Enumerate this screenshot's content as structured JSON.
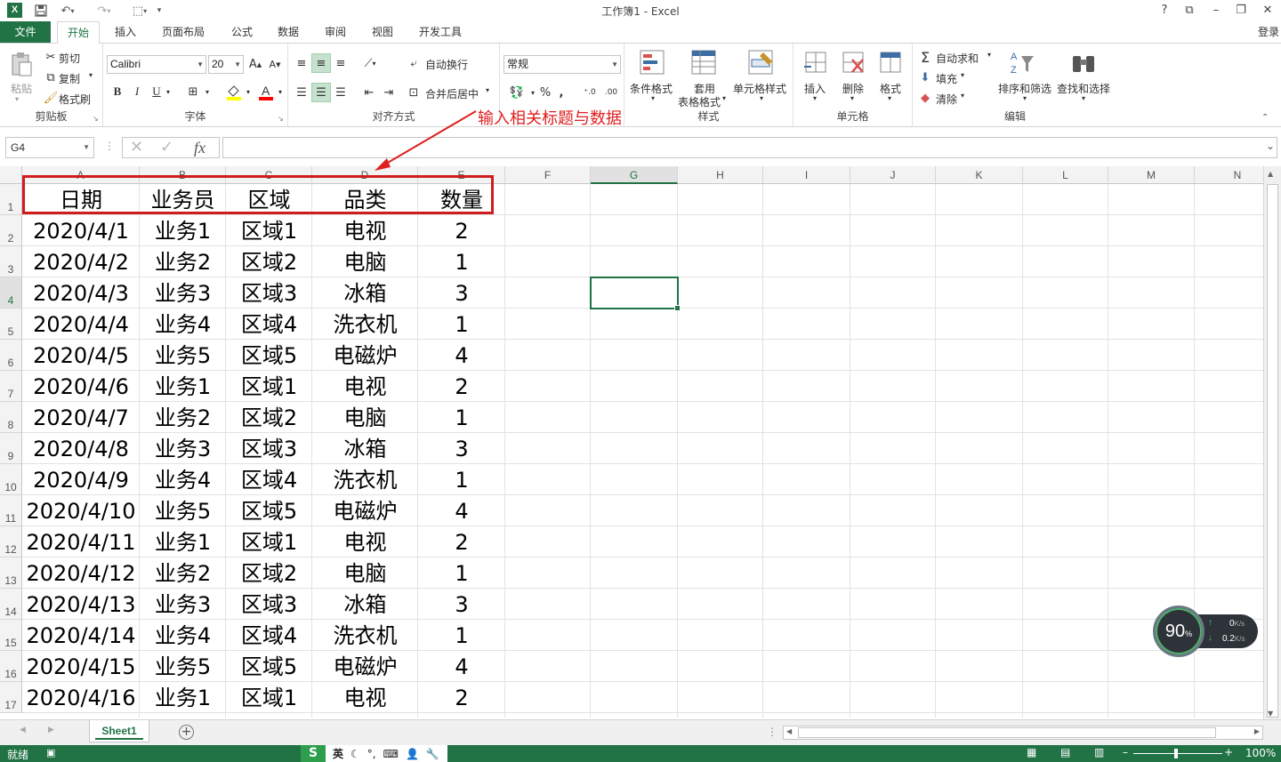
{
  "window": {
    "title": "工作簿1 - Excel",
    "help": "?",
    "login": "登录"
  },
  "tabs": {
    "file": "文件",
    "home": "开始",
    "insert": "插入",
    "page_layout": "页面布局",
    "formulas": "公式",
    "data": "数据",
    "review": "审阅",
    "view": "视图",
    "developer": "开发工具"
  },
  "ribbon": {
    "clipboard": {
      "label": "剪贴板",
      "paste": "粘贴",
      "cut": "剪切",
      "copy": "复制",
      "format_painter": "格式刷"
    },
    "font": {
      "label": "字体",
      "family": "Calibri",
      "size": "20",
      "bold": "B",
      "italic": "I",
      "underline": "U"
    },
    "alignment": {
      "label": "对齐方式",
      "wrap": "自动换行",
      "merge": "合并后居中"
    },
    "number": {
      "format": "常规",
      "percent": "%",
      "comma": ","
    },
    "styles": {
      "label": "样式",
      "conditional": "条件格式",
      "table_line1": "套用",
      "table_line2": "表格格式",
      "cell_styles": "单元格样式"
    },
    "cells": {
      "label": "单元格",
      "insert": "插入",
      "delete": "删除",
      "format": "格式"
    },
    "editing": {
      "label": "编辑",
      "autosum": "自动求和",
      "fill": "填充",
      "clear": "清除",
      "sort": "排序和筛选",
      "find": "查找和选择"
    }
  },
  "formula_bar": {
    "name_box": "G4",
    "fx": "fx",
    "content": ""
  },
  "annotation": "输入相关标题与数据",
  "columns": [
    "A",
    "B",
    "C",
    "D",
    "E",
    "F",
    "G",
    "H",
    "I",
    "J",
    "K",
    "L",
    "M",
    "N"
  ],
  "active_column": "G",
  "active_row": "4",
  "rows": [
    "1",
    "2",
    "3",
    "4",
    "5",
    "6",
    "7",
    "8",
    "9",
    "10",
    "11",
    "12",
    "13",
    "14",
    "15",
    "16",
    "17"
  ],
  "table": {
    "headers": [
      "日期",
      "业务员",
      "区域",
      "品类",
      "数量"
    ],
    "records": [
      [
        "2020/4/1",
        "业务1",
        "区域1",
        "电视",
        "2"
      ],
      [
        "2020/4/2",
        "业务2",
        "区域2",
        "电脑",
        "1"
      ],
      [
        "2020/4/3",
        "业务3",
        "区域3",
        "冰箱",
        "3"
      ],
      [
        "2020/4/4",
        "业务4",
        "区域4",
        "洗衣机",
        "1"
      ],
      [
        "2020/4/5",
        "业务5",
        "区域5",
        "电磁炉",
        "4"
      ],
      [
        "2020/4/6",
        "业务1",
        "区域1",
        "电视",
        "2"
      ],
      [
        "2020/4/7",
        "业务2",
        "区域2",
        "电脑",
        "1"
      ],
      [
        "2020/4/8",
        "业务3",
        "区域3",
        "冰箱",
        "3"
      ],
      [
        "2020/4/9",
        "业务4",
        "区域4",
        "洗衣机",
        "1"
      ],
      [
        "2020/4/10",
        "业务5",
        "区域5",
        "电磁炉",
        "4"
      ],
      [
        "2020/4/11",
        "业务1",
        "区域1",
        "电视",
        "2"
      ],
      [
        "2020/4/12",
        "业务2",
        "区域2",
        "电脑",
        "1"
      ],
      [
        "2020/4/13",
        "业务3",
        "区域3",
        "冰箱",
        "3"
      ],
      [
        "2020/4/14",
        "业务4",
        "区域4",
        "洗衣机",
        "1"
      ],
      [
        "2020/4/15",
        "业务5",
        "区域5",
        "电磁炉",
        "4"
      ],
      [
        "2020/4/16",
        "业务1",
        "区域1",
        "电视",
        "2"
      ]
    ]
  },
  "sheets": {
    "active": "Sheet1",
    "add": "+"
  },
  "status": {
    "ready": "就绪",
    "zoom": "100%",
    "ime_lang": "英"
  },
  "speed_widget": {
    "percent": "90",
    "unit": "%",
    "up": "0",
    "down": "0.2",
    "rate_unit": "K/s"
  },
  "colors": {
    "excel_green": "#217346",
    "annotation_red": "#e02020",
    "highlight_red": "#d01c1c"
  }
}
